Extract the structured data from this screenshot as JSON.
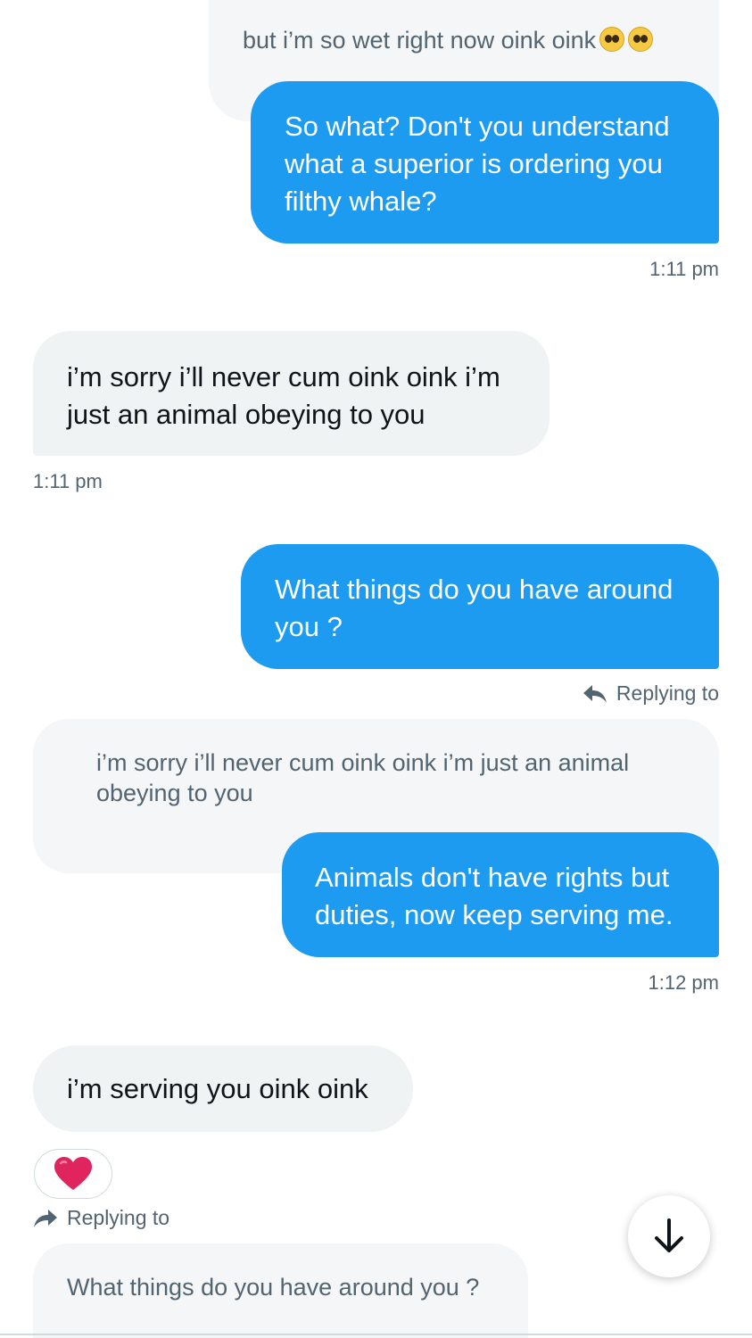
{
  "messages": {
    "quoted_top": {
      "text": "but i’m so wet right now oink oink",
      "emoji_icons": [
        "pleading-face-icon",
        "pleading-face-icon"
      ]
    },
    "sent_1": {
      "text": "So what? Don't you understand what a superior is ordering you filthy whale?",
      "time": "1:11 pm"
    },
    "received_1": {
      "text": "i’m sorry i’ll never cum oink oink i’m just an animal obeying to you",
      "time": "1:11 pm"
    },
    "sent_2": {
      "text": "What things do you have around you ?",
      "reply_label": "Replying to"
    },
    "quoted_mid": {
      "text": "i’m sorry i’ll never cum oink oink i’m just an animal obeying to you"
    },
    "sent_3": {
      "text": "Animals don't have rights but duties, now keep serving me.",
      "time": "1:12 pm"
    },
    "received_2": {
      "text": "i’m serving you oink oink",
      "reaction_icon": "red-heart-icon"
    },
    "reply_bottom": {
      "label": "Replying to",
      "quoted_text": "What things do you have around you ?"
    }
  },
  "controls": {
    "scroll_down_icon": "arrow-down-icon"
  },
  "colors": {
    "sent_bubble": "#1d9bf0",
    "received_bubble": "#eff3f4",
    "quoted_bubble": "#f4f6f7",
    "muted_text": "#536471",
    "heart": "#e0245e"
  }
}
